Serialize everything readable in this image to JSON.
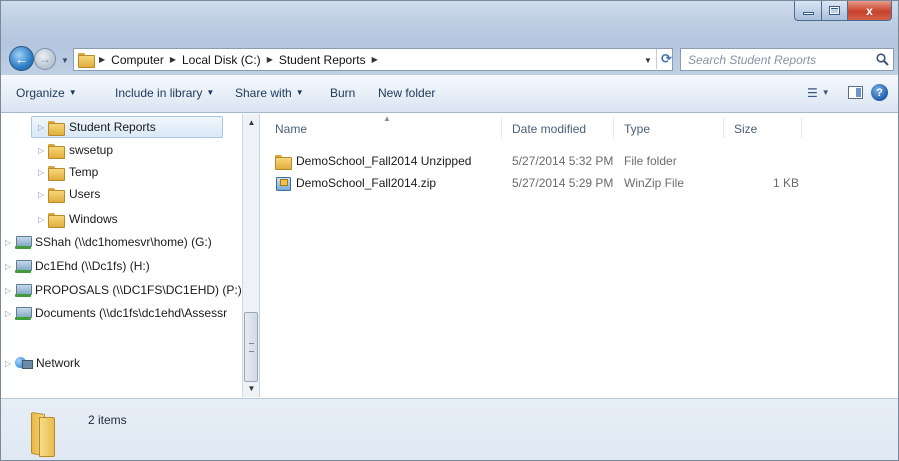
{
  "window": {
    "controls": {
      "minimize_icon": "minimize-icon",
      "maximize_icon": "maximize-icon",
      "close_label": "x"
    }
  },
  "address_bar": {
    "breadcrumbs": [
      "Computer",
      "Local Disk (C:)",
      "Student Reports"
    ],
    "search_placeholder": "Search Student Reports"
  },
  "toolbar": {
    "organize": "Organize",
    "include_in_library": "Include in library",
    "share_with": "Share with",
    "burn": "Burn",
    "new_folder": "New folder"
  },
  "nav_pane": {
    "folders": [
      {
        "label": "Student Reports",
        "selected": true
      },
      {
        "label": "swsetup"
      },
      {
        "label": "Temp"
      },
      {
        "label": "Users"
      },
      {
        "label": "Windows"
      }
    ],
    "drives": [
      {
        "label": "SShah (\\\\dc1homesvr\\home) (G:)"
      },
      {
        "label": "Dc1Ehd (\\\\Dc1fs) (H:)"
      },
      {
        "label": "PROPOSALS (\\\\DC1FS\\DC1EHD) (P:)"
      },
      {
        "label": "Documents (\\\\dc1fs\\dc1ehd\\Assessr"
      }
    ],
    "network": "Network"
  },
  "file_list": {
    "columns": [
      "Name",
      "Date modified",
      "Type",
      "Size"
    ],
    "rows": [
      {
        "name": "DemoSchool_Fall2014 Unzipped",
        "date": "5/27/2014 5:32 PM",
        "type": "File folder",
        "size": "",
        "icon": "folder-icon"
      },
      {
        "name": "DemoSchool_Fall2014.zip",
        "date": "5/27/2014 5:29 PM",
        "type": "WinZip File",
        "size": "1 KB",
        "icon": "zip-file-icon"
      }
    ]
  },
  "details_pane": {
    "item_count": "2 items"
  },
  "colors": {
    "title_bar": "#bccde2",
    "command_bar": "#e9f0f8",
    "selection": "#d9e8f7",
    "close_button": "#c8432b"
  }
}
